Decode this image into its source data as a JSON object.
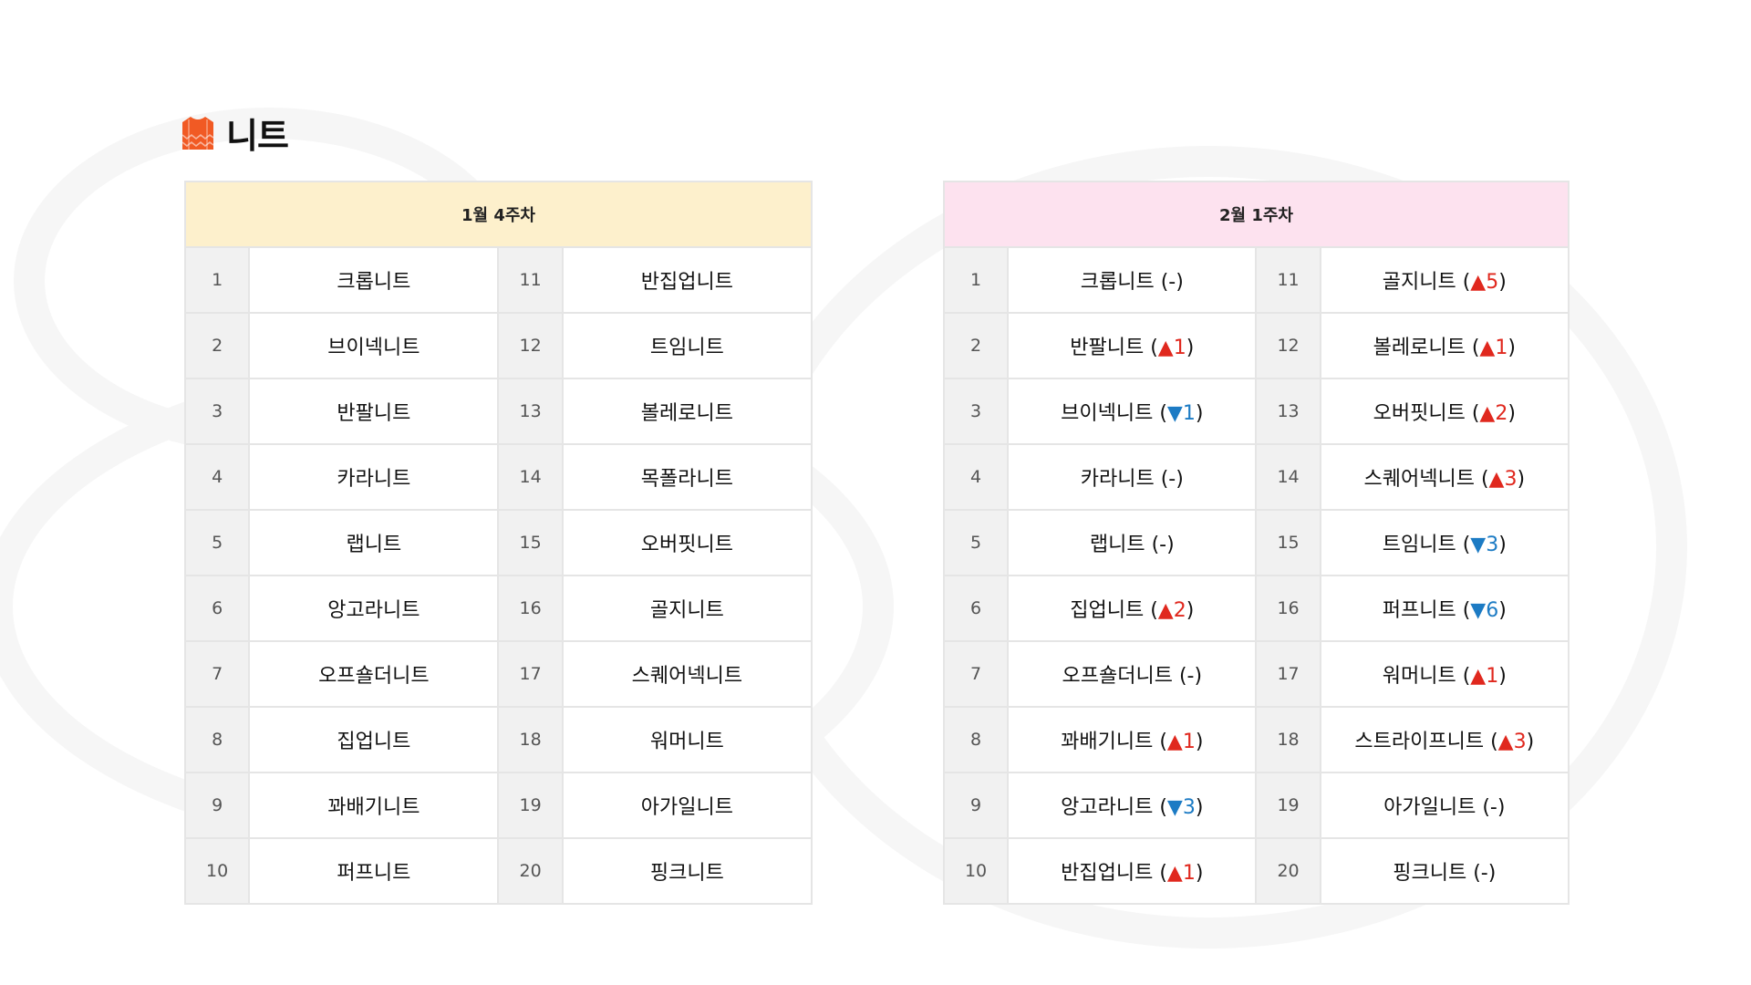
{
  "page": {
    "title": "니트"
  },
  "week1": {
    "header": "1월 4주차",
    "rows": [
      {
        "left": {
          "rank": "1",
          "name": "크롭니트"
        },
        "right": {
          "rank": "11",
          "name": "반집업니트"
        }
      },
      {
        "left": {
          "rank": "2",
          "name": "브이넥니트"
        },
        "right": {
          "rank": "12",
          "name": "트임니트"
        }
      },
      {
        "left": {
          "rank": "3",
          "name": "반팔니트"
        },
        "right": {
          "rank": "13",
          "name": "볼레로니트"
        }
      },
      {
        "left": {
          "rank": "4",
          "name": "카라니트"
        },
        "right": {
          "rank": "14",
          "name": "목폴라니트"
        }
      },
      {
        "left": {
          "rank": "5",
          "name": "랩니트"
        },
        "right": {
          "rank": "15",
          "name": "오버핏니트"
        }
      },
      {
        "left": {
          "rank": "6",
          "name": "앙고라니트"
        },
        "right": {
          "rank": "16",
          "name": "골지니트"
        }
      },
      {
        "left": {
          "rank": "7",
          "name": "오프숄더니트"
        },
        "right": {
          "rank": "17",
          "name": "스퀘어넥니트"
        }
      },
      {
        "left": {
          "rank": "8",
          "name": "집업니트"
        },
        "right": {
          "rank": "18",
          "name": "워머니트"
        }
      },
      {
        "left": {
          "rank": "9",
          "name": "꽈배기니트"
        },
        "right": {
          "rank": "19",
          "name": "아가일니트"
        }
      },
      {
        "left": {
          "rank": "10",
          "name": "퍼프니트"
        },
        "right": {
          "rank": "20",
          "name": "핑크니트"
        }
      }
    ]
  },
  "week2": {
    "header": "2월 1주차",
    "rows": [
      {
        "left": {
          "rank": "1",
          "name": "크롭니트",
          "change": "-"
        },
        "right": {
          "rank": "11",
          "name": "골지니트",
          "change": "▲5"
        }
      },
      {
        "left": {
          "rank": "2",
          "name": "반팔니트",
          "change": "▲1"
        },
        "right": {
          "rank": "12",
          "name": "볼레로니트",
          "change": "▲1"
        }
      },
      {
        "left": {
          "rank": "3",
          "name": "브이넥니트",
          "change": "▼1"
        },
        "right": {
          "rank": "13",
          "name": "오버핏니트",
          "change": "▲2"
        }
      },
      {
        "left": {
          "rank": "4",
          "name": "카라니트",
          "change": "-"
        },
        "right": {
          "rank": "14",
          "name": "스퀘어넥니트",
          "change": "▲3"
        }
      },
      {
        "left": {
          "rank": "5",
          "name": "랩니트",
          "change": "-"
        },
        "right": {
          "rank": "15",
          "name": "트임니트",
          "change": "▼3"
        }
      },
      {
        "left": {
          "rank": "6",
          "name": "집업니트",
          "change": "▲2"
        },
        "right": {
          "rank": "16",
          "name": "퍼프니트",
          "change": "▼6"
        }
      },
      {
        "left": {
          "rank": "7",
          "name": "오프숄더니트",
          "change": "-"
        },
        "right": {
          "rank": "17",
          "name": "워머니트",
          "change": "▲1"
        }
      },
      {
        "left": {
          "rank": "8",
          "name": "꽈배기니트",
          "change": "▲1"
        },
        "right": {
          "rank": "18",
          "name": "스트라이프니트",
          "change": "▲3"
        }
      },
      {
        "left": {
          "rank": "9",
          "name": "앙고라니트",
          "change": "▼3"
        },
        "right": {
          "rank": "19",
          "name": "아가일니트",
          "change": "-"
        }
      },
      {
        "left": {
          "rank": "10",
          "name": "반집업니트",
          "change": "▲1"
        },
        "right": {
          "rank": "20",
          "name": "핑크니트",
          "change": "-"
        }
      }
    ]
  },
  "colors": {
    "up": "#e0281e",
    "down": "#1c7bc4",
    "week1_header_bg": "#fdf0cc",
    "week2_header_bg": "#fde2ef",
    "icon": "#f15a24"
  },
  "icons": {
    "title": "sweater-icon"
  }
}
